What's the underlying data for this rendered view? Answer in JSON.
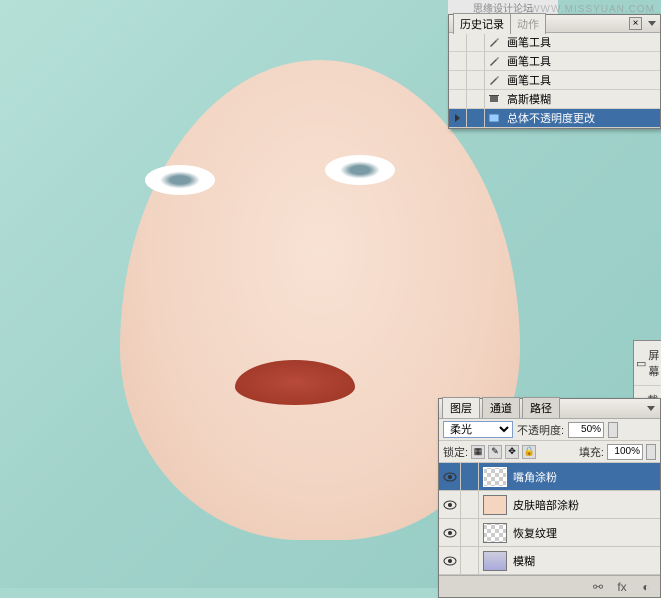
{
  "watermark": "WWW.MISSYUAN.COM",
  "app_title": "思缘设计论坛",
  "history": {
    "tab1": "历史记录",
    "tab2": "动作",
    "items": [
      {
        "icon": "brush",
        "label": "画笔工具"
      },
      {
        "icon": "brush",
        "label": "画笔工具"
      },
      {
        "icon": "brush",
        "label": "画笔工具"
      },
      {
        "icon": "blur",
        "label": "高斯模糊"
      },
      {
        "icon": "opacity",
        "label": "总体不透明度更改",
        "selected": true
      }
    ]
  },
  "side": {
    "item1": "屏幕",
    "item2": "截图"
  },
  "layers": {
    "tabs": {
      "t1": "图层",
      "t2": "通道",
      "t3": "路径"
    },
    "blend_mode": "柔光",
    "opacity_label": "不透明度:",
    "opacity_value": "50%",
    "lock_label": "锁定:",
    "fill_label": "填充:",
    "fill_value": "100%",
    "rows": [
      {
        "name": "嘴角涂粉",
        "thumb": "check",
        "selected": true
      },
      {
        "name": "皮肤暗部涂粉",
        "thumb": "skin"
      },
      {
        "name": "恢复纹理",
        "thumb": "check"
      },
      {
        "name": "模糊",
        "thumb": "img"
      }
    ]
  }
}
